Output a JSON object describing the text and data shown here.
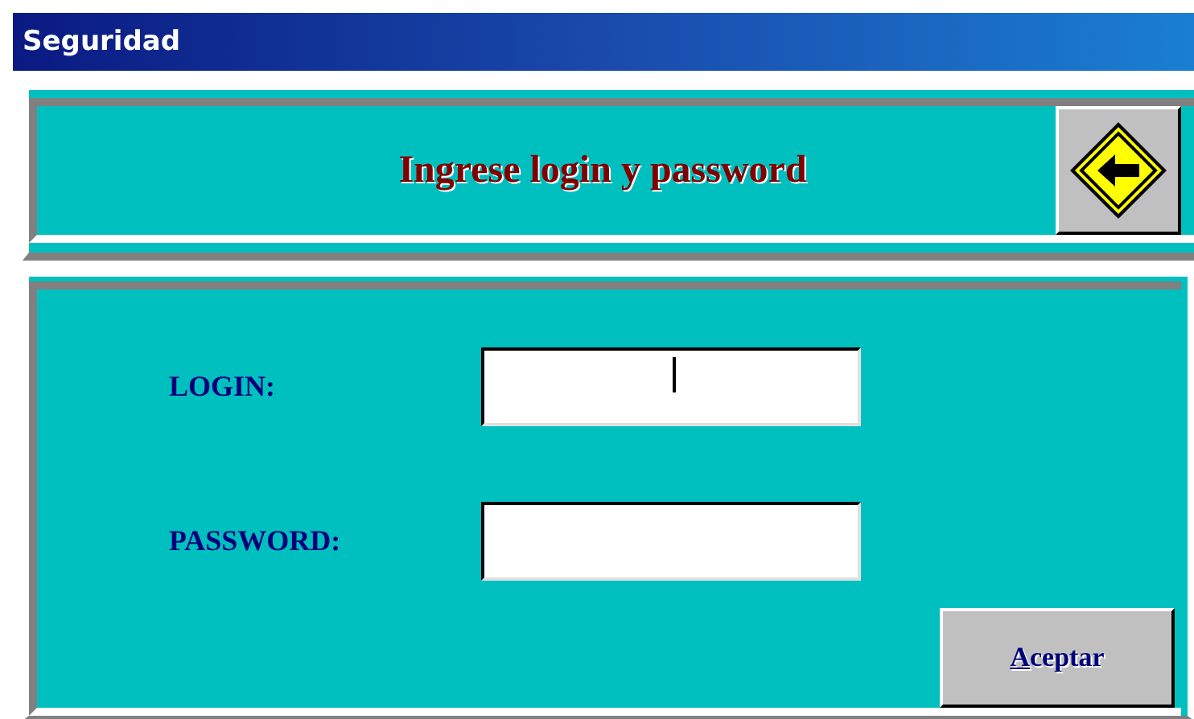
{
  "window": {
    "title": "Seguridad"
  },
  "header": {
    "message": "Ingrese login y password"
  },
  "form": {
    "fields": [
      {
        "label": "LOGIN:",
        "focused": true
      },
      {
        "label": "PASSWORD:",
        "focused": false
      }
    ],
    "submit": {
      "label": "Aceptar"
    }
  }
}
